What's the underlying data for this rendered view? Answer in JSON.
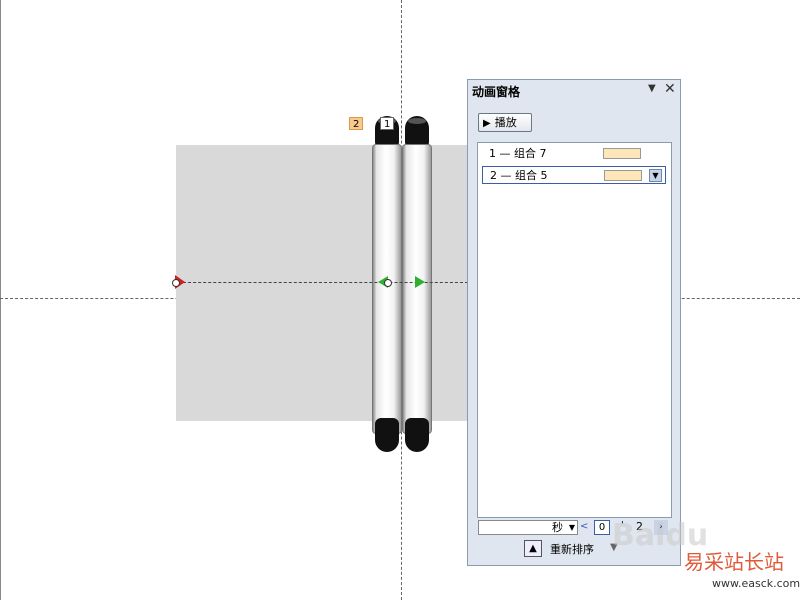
{
  "slide": {
    "tags": {
      "tag_2": "2",
      "tag_1": "1"
    }
  },
  "pane": {
    "title": "动画窗格",
    "dropdown_icon": "triangle-down-icon",
    "close_icon": "close-icon",
    "play_label": "播放",
    "items": [
      {
        "text": "1 — 组合 7",
        "selected": false
      },
      {
        "text": "2 — 组合 5",
        "selected": true
      }
    ],
    "seconds_label": "秒",
    "timeline": {
      "start": "0",
      "mid_tick": "'",
      "end": "2"
    },
    "reorder_label": "重新排序"
  },
  "watermark": {
    "baidu": "Baidu",
    "site_cn": "易采站长站",
    "url": "www.easck.com"
  },
  "colors": {
    "timing_bar": "#fde6b8",
    "path_start": "#d21e1e",
    "path_end": "#2fb12f",
    "selection": "#3a5da8"
  }
}
